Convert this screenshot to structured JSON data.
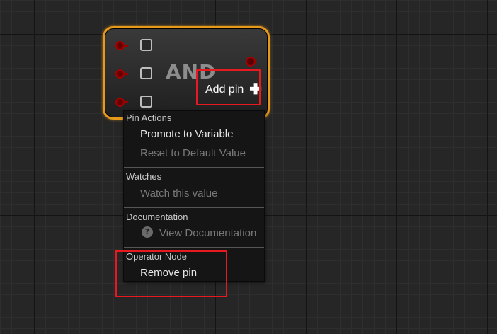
{
  "node": {
    "title": "AND",
    "add_pin_label": "Add pin",
    "add_pin_icon": "plus-icon"
  },
  "context_menu": {
    "sections": [
      {
        "header": "Pin Actions",
        "items": [
          {
            "label": "Promote to Variable",
            "enabled": true
          },
          {
            "label": "Reset to Default Value",
            "enabled": false
          }
        ]
      },
      {
        "header": "Watches",
        "items": [
          {
            "label": "Watch this value",
            "enabled": false
          }
        ]
      },
      {
        "header": "Documentation",
        "items": [
          {
            "label": "View Documentation",
            "enabled": false,
            "icon": "help-icon"
          }
        ]
      },
      {
        "header": "Operator Node",
        "items": [
          {
            "label": "Remove pin",
            "enabled": true
          }
        ]
      }
    ]
  },
  "colors": {
    "node_border": "#e79a1a",
    "annotation": "#e8191f",
    "exec_pin": "#a30000"
  }
}
